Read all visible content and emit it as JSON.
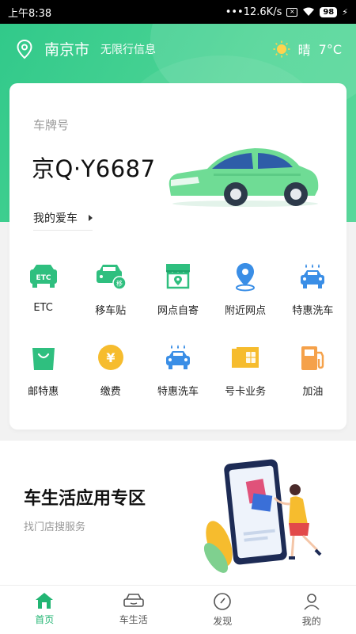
{
  "status_bar": {
    "time": "上午8:38",
    "speed": "12.6K/s",
    "battery": "98"
  },
  "header": {
    "city": "南京市",
    "restriction": "无限行信息",
    "weather": "晴",
    "temperature": "7°C"
  },
  "car_card": {
    "plate_label": "车牌号",
    "plate_number": "京Q·Y6687",
    "my_car_label": "我的爱车"
  },
  "services": [
    {
      "label": "ETC",
      "icon": "etc-icon"
    },
    {
      "label": "移车贴",
      "icon": "move-car-icon"
    },
    {
      "label": "网点自寄",
      "icon": "store-mail-icon"
    },
    {
      "label": "附近网点",
      "icon": "location-pin-icon"
    },
    {
      "label": "特惠洗车",
      "icon": "car-wash-icon"
    },
    {
      "label": "邮特惠",
      "icon": "shopping-bag-icon"
    },
    {
      "label": "缴费",
      "icon": "yuan-coin-icon"
    },
    {
      "label": "特惠洗车",
      "icon": "car-wash-icon"
    },
    {
      "label": "号卡业务",
      "icon": "sim-card-icon"
    },
    {
      "label": "加油",
      "icon": "fuel-icon"
    }
  ],
  "promo": {
    "title": "车生活应用专区",
    "subtitle": "找门店搜服务"
  },
  "nav": [
    {
      "label": "首页",
      "icon": "home-icon",
      "active": true
    },
    {
      "label": "车生活",
      "icon": "car-life-icon",
      "active": false
    },
    {
      "label": "发现",
      "icon": "compass-icon",
      "active": false
    },
    {
      "label": "我的",
      "icon": "profile-icon",
      "active": false
    }
  ],
  "colors": {
    "accent": "#22b573",
    "header_green": "#3ecf8e",
    "blue": "#3a8ee6",
    "yellow": "#f6bc2e",
    "orange": "#f5a14a"
  }
}
